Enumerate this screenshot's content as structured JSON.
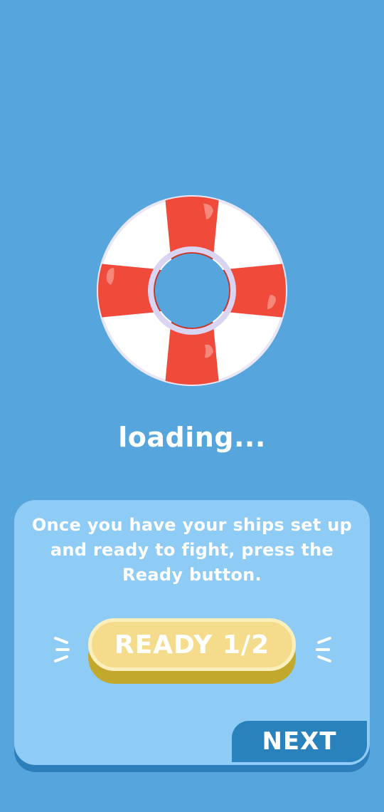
{
  "loading": {
    "text": "loading..."
  },
  "tutorial": {
    "tip_text": "Once you have your ships set up and ready to fight, press the Ready button.",
    "ready_button_label": "READY 1/2",
    "next_button_label": "NEXT"
  },
  "colors": {
    "background": "#56a6dd",
    "card": "#8ecbf5",
    "ready_button": "#f4dc8c",
    "next_button": "#2a82bd",
    "lifebuoy_red": "#ef4a3a"
  }
}
